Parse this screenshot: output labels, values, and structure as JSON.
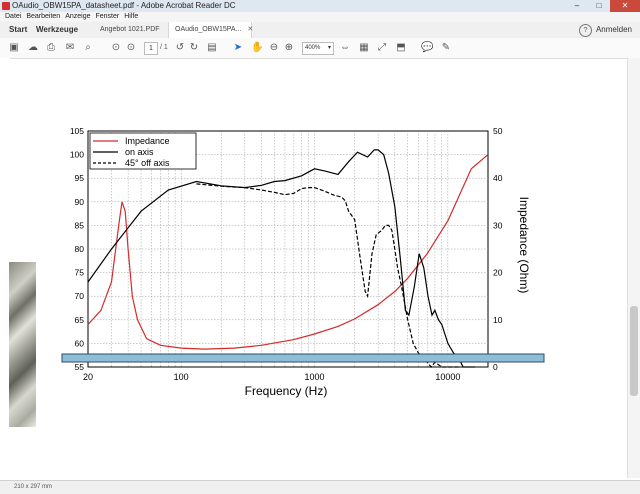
{
  "window": {
    "title": "OAudio_OBW15PA_datasheet.pdf - Adobe Acrobat Reader DC"
  },
  "menu": [
    "Datei",
    "Bearbeiten",
    "Anzeige",
    "Fenster",
    "Hilfe"
  ],
  "tabs": {
    "start": "Start",
    "tools": "Werkzeuge",
    "doc1": "Angebot 1021.PDF",
    "doc2": "OAudio_OBW15PA..."
  },
  "signin": "Anmelden",
  "toolbar": {
    "page_current": "1",
    "page_total": "/ 1",
    "zoom": "400%"
  },
  "status": {
    "page_size": "210 x 297 mm"
  },
  "colors": {
    "impedance": "#d42a2a",
    "on_axis": "#000000",
    "off_axis": "#000000",
    "highlight_bar": "#8fbcd6"
  },
  "chart_data": {
    "type": "line",
    "xlabel": "Frequency (Hz)",
    "ylabel_right": "Impedance (Ohm)",
    "xscale": "log",
    "xlim": [
      20,
      20000
    ],
    "ylim_left": [
      55,
      105
    ],
    "ylim_right": [
      0,
      50
    ],
    "xticks": [
      20,
      100,
      1000,
      10000
    ],
    "yticks_left": [
      55,
      60,
      65,
      70,
      75,
      80,
      85,
      90,
      95,
      100,
      105
    ],
    "yticks_right": [
      0,
      10,
      20,
      30,
      40,
      50
    ],
    "legend_position": "top-left",
    "grid": true,
    "series": [
      {
        "name": "Impedance",
        "axis": "right",
        "x": [
          20,
          25,
          30,
          34,
          36,
          38,
          40,
          43,
          47,
          55,
          70,
          100,
          150,
          250,
          400,
          700,
          1000,
          1500,
          2000,
          3000,
          4000,
          5000,
          7000,
          10000,
          15000,
          20000
        ],
        "y": [
          9,
          12,
          18,
          30,
          35,
          33,
          25,
          15,
          10,
          6,
          4.6,
          4,
          3.8,
          4,
          4.6,
          5.8,
          7,
          8.6,
          10.2,
          13.2,
          16,
          18.8,
          24,
          31,
          42,
          45
        ]
      },
      {
        "name": "on axis",
        "axis": "left",
        "x": [
          20,
          30,
          50,
          80,
          130,
          200,
          300,
          400,
          500,
          600,
          800,
          1000,
          1200,
          1500,
          1800,
          2100,
          2500,
          2800,
          3000,
          3300,
          3600,
          4000,
          4400,
          4800,
          5100,
          5600,
          6100,
          6600,
          7100,
          7600,
          8000,
          8500,
          9000,
          10000,
          11000,
          12000,
          13000,
          14000,
          15000,
          16000
        ],
        "y": [
          73,
          80,
          88,
          92.5,
          94.3,
          93.4,
          93,
          93.5,
          94.3,
          94.5,
          95.5,
          97,
          96.5,
          95.8,
          98.5,
          100.5,
          99.5,
          101,
          101,
          100,
          96,
          89,
          78,
          67,
          66,
          72,
          79,
          76,
          70,
          66,
          67,
          65,
          64,
          60,
          58,
          57,
          55,
          52,
          50,
          48
        ]
      },
      {
        "name": "45° off axis",
        "axis": "left",
        "x": [
          130,
          200,
          300,
          400,
          500,
          600,
          700,
          800,
          900,
          1000,
          1200,
          1400,
          1600,
          1700,
          1800,
          2000,
          2200,
          2400,
          2500,
          2700,
          2900,
          3200,
          3400,
          3600,
          3800,
          4000,
          4200,
          4500,
          5000,
          5500,
          6000,
          6500,
          7000,
          7500,
          8000,
          9000,
          10000,
          11000,
          12000
        ],
        "y": [
          93.8,
          93.3,
          93,
          92.5,
          92,
          91.5,
          91.8,
          92.8,
          93,
          93,
          92.2,
          91.4,
          91,
          90.2,
          88,
          86.2,
          78,
          71,
          70,
          79,
          83,
          84,
          85,
          85,
          84,
          80,
          76,
          72,
          65,
          60,
          58,
          57,
          56,
          55,
          56,
          55,
          53,
          50,
          48
        ]
      }
    ]
  }
}
